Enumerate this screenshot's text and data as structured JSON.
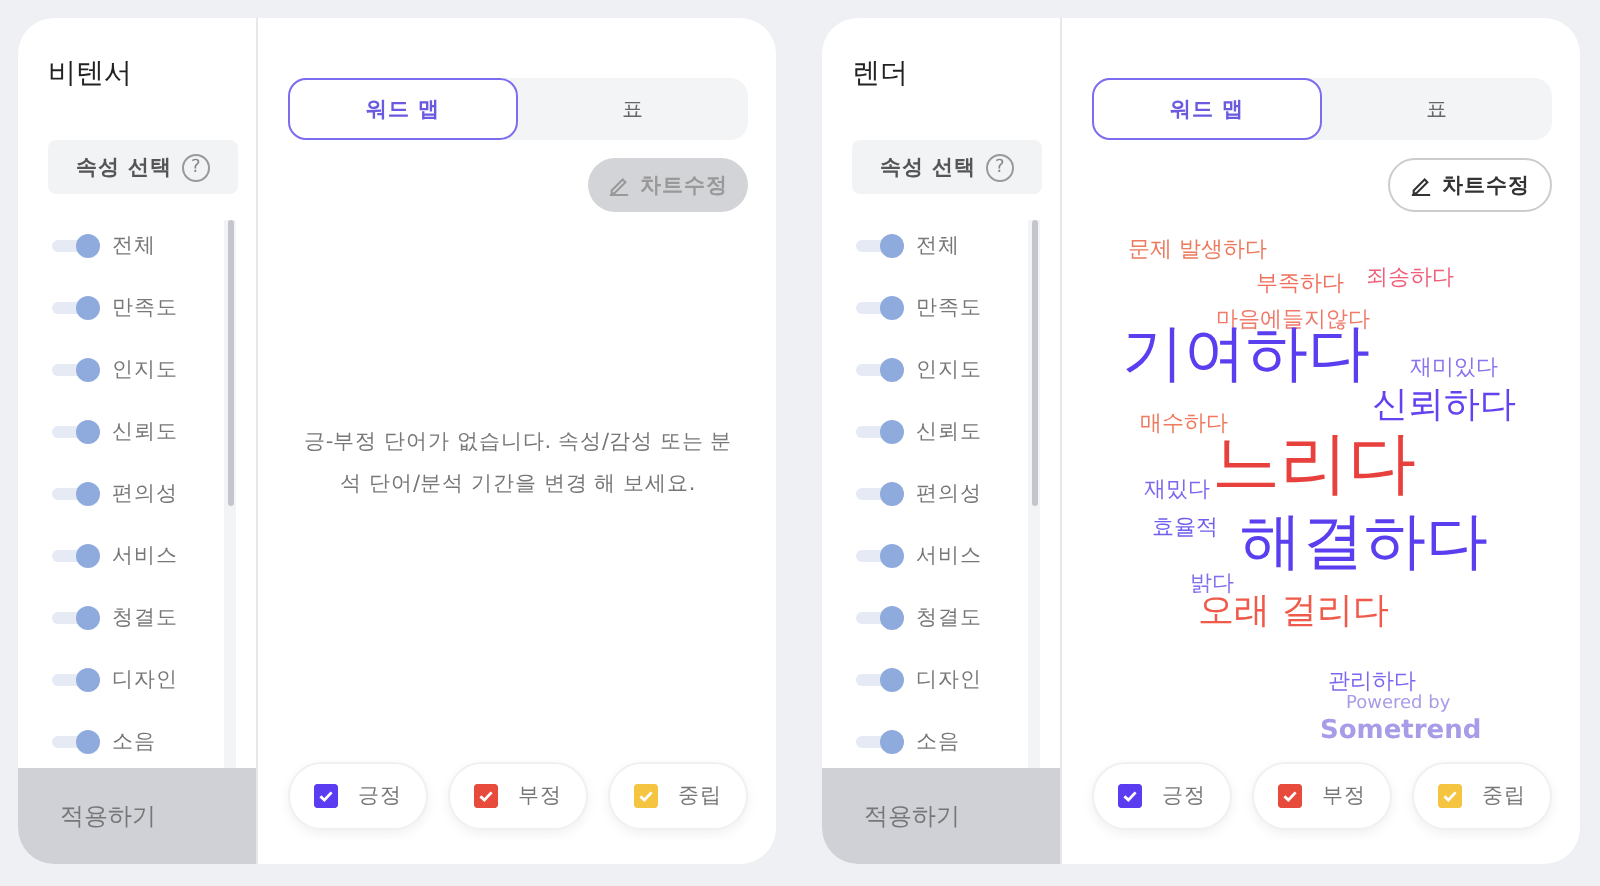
{
  "cards": [
    {
      "brand": "비텐서",
      "attribute_select": {
        "label": "속성 선택",
        "help": "?"
      },
      "attributes": [
        {
          "label": "전체",
          "on": true
        },
        {
          "label": "만족도",
          "on": true
        },
        {
          "label": "인지도",
          "on": true
        },
        {
          "label": "신뢰도",
          "on": true
        },
        {
          "label": "편의성",
          "on": true
        },
        {
          "label": "서비스",
          "on": true
        },
        {
          "label": "청결도",
          "on": true
        },
        {
          "label": "디자인",
          "on": true
        },
        {
          "label": "소음",
          "on": true
        }
      ],
      "apply_button": "적용하기",
      "tabs": [
        {
          "label": "워드 맵",
          "selected": true
        },
        {
          "label": "표",
          "selected": false
        }
      ],
      "chart_edit": {
        "label": "차트수정",
        "disabled": true
      },
      "empty_message": "긍-부정 단어가 없습니다. 속성/감성 또는 분석 단어/분석 기간을 변경 해 보세요.",
      "legend": [
        {
          "label": "긍정",
          "checked": true,
          "color": "#5b3cf0"
        },
        {
          "label": "부정",
          "checked": true,
          "color": "#e84b3c"
        },
        {
          "label": "중립",
          "checked": true,
          "color": "#f5c542"
        }
      ]
    },
    {
      "brand": "렌더",
      "attribute_select": {
        "label": "속성 선택",
        "help": "?"
      },
      "attributes": [
        {
          "label": "전체",
          "on": true
        },
        {
          "label": "만족도",
          "on": true
        },
        {
          "label": "인지도",
          "on": true
        },
        {
          "label": "신뢰도",
          "on": true
        },
        {
          "label": "편의성",
          "on": true
        },
        {
          "label": "서비스",
          "on": true
        },
        {
          "label": "청결도",
          "on": true
        },
        {
          "label": "디자인",
          "on": true
        },
        {
          "label": "소음",
          "on": true
        }
      ],
      "apply_button": "적용하기",
      "tabs": [
        {
          "label": "워드 맵",
          "selected": true
        },
        {
          "label": "표",
          "selected": false
        }
      ],
      "chart_edit": {
        "label": "차트수정",
        "disabled": false
      },
      "words": [
        {
          "text": "문제 발생하다",
          "kind": "small",
          "color": "#ec7a5e"
        },
        {
          "text": "부족하다",
          "kind": "small",
          "color": "#f0705e"
        },
        {
          "text": "죄송하다",
          "kind": "small",
          "color": "#f0607a"
        },
        {
          "text": "마음에들지않다",
          "kind": "small",
          "color": "#f07a6a"
        },
        {
          "text": "기여하다",
          "kind": "large",
          "color": "#5a3ff0"
        },
        {
          "text": "재미있다",
          "kind": "small",
          "color": "#8a72f2"
        },
        {
          "text": "신뢰하다",
          "kind": "medium",
          "color": "#6442f0"
        },
        {
          "text": "매수하다",
          "kind": "small",
          "color": "#f07a5e"
        },
        {
          "text": "재밌다",
          "kind": "small",
          "color": "#7c68f0"
        },
        {
          "text": "느리다",
          "kind": "xlarge",
          "color": "#e8403c"
        },
        {
          "text": "효율적",
          "kind": "small",
          "color": "#7060f0"
        },
        {
          "text": "해결하다",
          "kind": "large",
          "color": "#5a3ff0"
        },
        {
          "text": "밝다",
          "kind": "small",
          "color": "#8070f0"
        },
        {
          "text": "오래 걸리다",
          "kind": "medium",
          "color": "#f05a4a"
        },
        {
          "text": "관리하다",
          "kind": "small",
          "color": "#7c68f0"
        }
      ],
      "powered_by": [
        "Powered by",
        "Sometrend"
      ],
      "legend": [
        {
          "label": "긍정",
          "checked": true,
          "color": "#5b3cf0"
        },
        {
          "label": "부정",
          "checked": true,
          "color": "#e84b3c"
        },
        {
          "label": "중립",
          "checked": true,
          "color": "#f5c542"
        }
      ]
    }
  ]
}
